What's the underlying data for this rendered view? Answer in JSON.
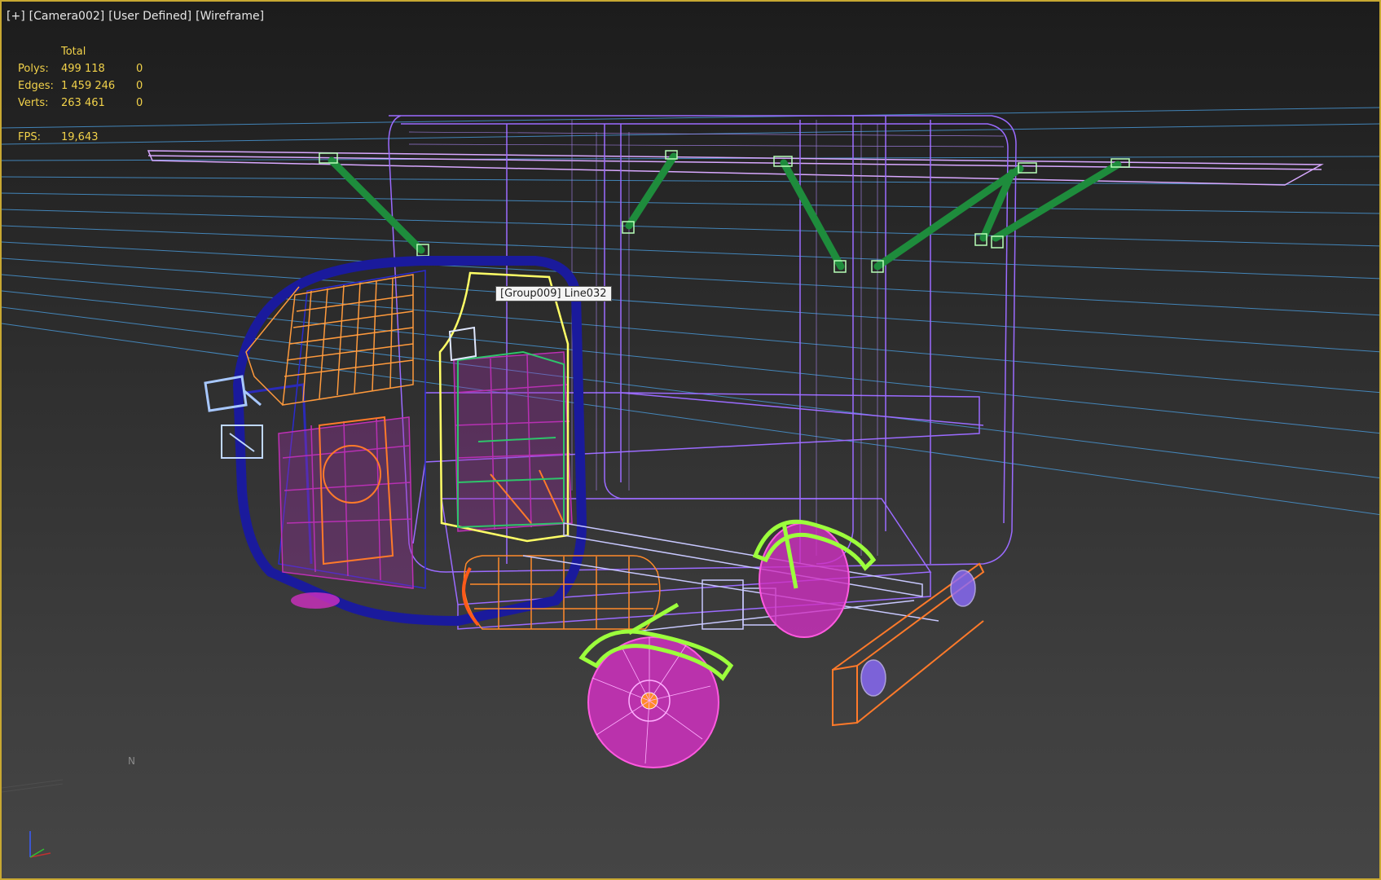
{
  "viewport": {
    "label_plus": "[+]",
    "label_camera": "[Camera002]",
    "label_view": "[User Defined]",
    "label_mode": "[Wireframe]"
  },
  "stats": {
    "header": "Total",
    "rows": [
      {
        "key": "Polys:",
        "value": "499 118",
        "selected": "0"
      },
      {
        "key": "Edges:",
        "value": "1 459 246",
        "selected": "0"
      },
      {
        "key": "Verts:",
        "value": "263 461",
        "selected": "0"
      }
    ],
    "fps_key": "FPS:",
    "fps_value": "19,643"
  },
  "tooltip": {
    "text": "[Group009] Line032"
  },
  "compass": {
    "label": "N"
  },
  "axis_gizmo": {
    "z": "z",
    "y": "y",
    "x": "x"
  },
  "colors": {
    "frame_border": "#c8a832",
    "stats_text": "#f2d24a",
    "wire_purple": "#9b6bff",
    "wire_pink": "#e040c8",
    "wire_green": "#1e8c3c",
    "wire_lime": "#9cff3c",
    "wire_orange": "#ff8a2a",
    "wire_navy": "#1a1a9c",
    "selection_yellow": "#ffff66",
    "horizon_lines": "#4a9cdc"
  }
}
